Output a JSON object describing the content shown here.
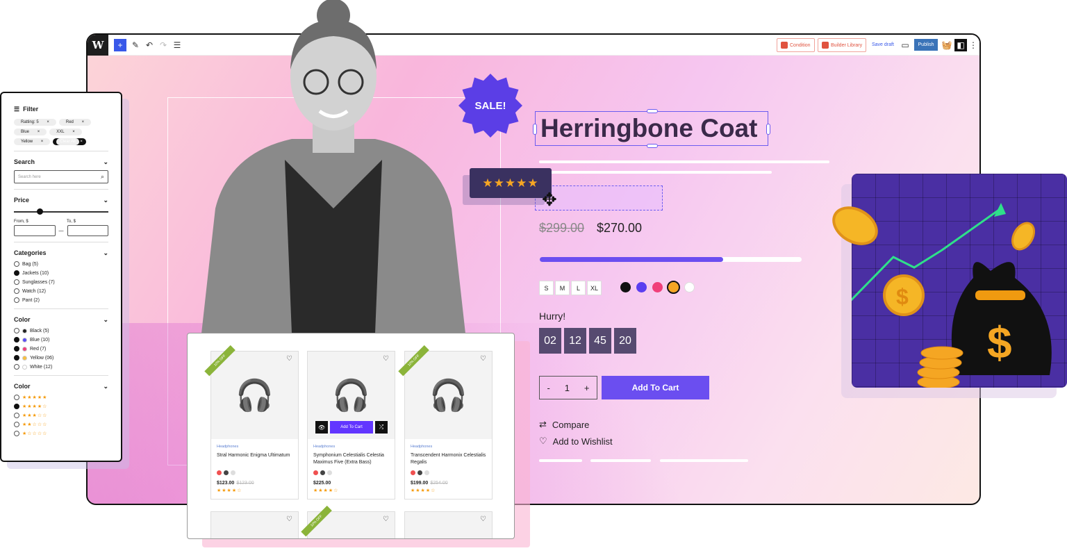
{
  "toolbar": {
    "logo": "W",
    "buttons": {
      "condition": "Condition",
      "builder_library": "Builder Library",
      "save_draft": "Save draft",
      "publish": "Publish"
    }
  },
  "product": {
    "sale_badge": "SALE!",
    "title": "Herringbone Coat",
    "rating_stars": "★★★★★",
    "old_price": "$299.00",
    "price": "$270.00",
    "stock_progress_percent": 70,
    "sizes": [
      "S",
      "M",
      "L",
      "XL"
    ],
    "colors": [
      "#111111",
      "#5b3ef0",
      "#f0407a",
      "#f5a623",
      "#ffffff"
    ],
    "hurry": "Hurry!",
    "countdown": [
      "02",
      "12",
      "45",
      "20"
    ],
    "quantity": "1",
    "qty_minus": "-",
    "qty_plus": "+",
    "add_to_cart": "Add To Cart",
    "compare": "Compare",
    "wishlist": "Add to Wishlist"
  },
  "filter": {
    "title": "Filter",
    "chips": [
      "Ratting: 5",
      "Red",
      "Blue",
      "XXL",
      "Yellow"
    ],
    "clear_all": "Clear All",
    "search_title": "Search",
    "search_placeholder": "Search here",
    "price_title": "Price",
    "from": "From, $",
    "to": "To, $",
    "categories_title": "Categories",
    "categories": [
      {
        "label": "Bag  (5)",
        "on": false
      },
      {
        "label": "Jackets  (10)",
        "on": true
      },
      {
        "label": "Sunglasses  (7)",
        "on": false
      },
      {
        "label": "Watch  (12)",
        "on": false
      },
      {
        "label": "Pant  (2)",
        "on": false
      }
    ],
    "color_title": "Color",
    "colors": [
      {
        "label": "Black  (5)",
        "c": "#222222",
        "on": false
      },
      {
        "label": "Blue  (10)",
        "c": "#5b4ef5",
        "on": true
      },
      {
        "label": "Red  (7)",
        "c": "#f0407a",
        "on": true
      },
      {
        "label": "Yellow  (06)",
        "c": "#f8c040",
        "on": true
      },
      {
        "label": "White  (12)",
        "c": "#ffffff",
        "on": false
      }
    ],
    "rating_title": "Color",
    "ratings": [
      {
        "stars": "★★★★★",
        "on": false
      },
      {
        "stars": "★★★★☆",
        "on": true
      },
      {
        "stars": "★★★☆☆",
        "on": false
      },
      {
        "stars": "★★☆☆☆",
        "on": false
      },
      {
        "stars": "★☆☆☆☆",
        "on": false
      }
    ]
  },
  "grid": {
    "products": [
      {
        "badge": "10% OFF",
        "category": "Headphones",
        "name": "Stral Harmonic Enigma Ultimatum",
        "price": "$123.00",
        "old_price": "$123.00",
        "stars": "★★★★☆"
      },
      {
        "badge": "",
        "category": "Headphones",
        "name": "Symphonium Celestialis Celestia Maximus Five (Extra Bass)",
        "price": "$225.00",
        "old_price": "",
        "stars": "★★★★☆",
        "add_to_cart": "Add To Cart"
      },
      {
        "badge": "10% OFF",
        "category": "Headphones",
        "name": "Transcendent Harmonix Celestialis Regalis",
        "price": "$199.00",
        "old_price": "$254.00",
        "stars": "★★★★☆"
      }
    ],
    "row2_badge": "10% OFF"
  },
  "money": {
    "symbol": "$"
  }
}
